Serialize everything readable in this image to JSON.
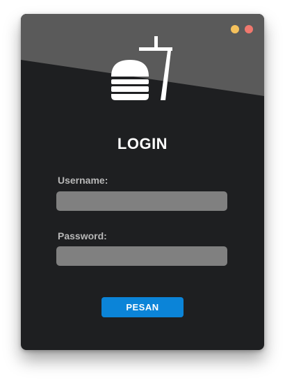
{
  "colors": {
    "window_bg": "#1e1f21",
    "header_band": "#5a5a5a",
    "input_bg": "#808080",
    "accent": "#0b84d8",
    "control_yellow": "#f5c15c",
    "control_red": "#f0786e"
  },
  "window": {
    "controls": [
      {
        "name": "minimize",
        "color": "#f5c15c"
      },
      {
        "name": "close",
        "color": "#f0786e"
      }
    ]
  },
  "logo": {
    "icon": "burger-and-drink-icon"
  },
  "login": {
    "title": "LOGIN",
    "username_label": "Username:",
    "username_value": "",
    "password_label": "Password:",
    "password_value": "",
    "submit_label": "PESAN"
  }
}
